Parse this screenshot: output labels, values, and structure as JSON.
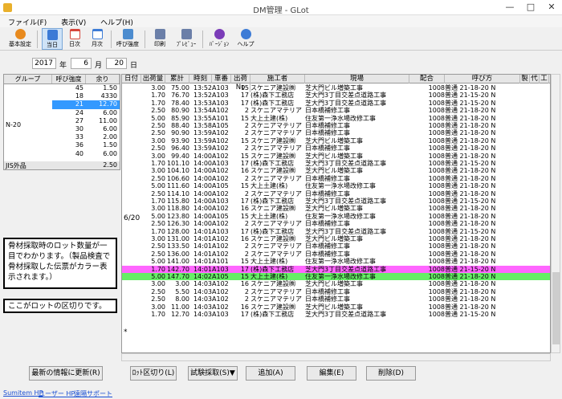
{
  "window": {
    "title": "DM管理 - GLot",
    "minimize": "—",
    "maximize": "□",
    "close": "✕"
  },
  "menu": [
    "ファイル(F)",
    "表示(V)",
    "ヘルプ(H)"
  ],
  "toolbar": [
    {
      "label": "基本設定",
      "icon": "gear-icon",
      "color": "#e88a1e"
    },
    {
      "label": "当日",
      "icon": "calendar-today-icon",
      "color": "#3c7bd6"
    },
    {
      "label": "日次",
      "icon": "calendar-day-icon",
      "color": "#d6463c"
    },
    {
      "label": "月次",
      "icon": "calendar-month-icon",
      "color": "#3c7bd6"
    },
    {
      "label": "呼び強度",
      "icon": "strength-icon",
      "color": "#4c8ccf"
    },
    {
      "label": "印刷",
      "icon": "print-icon",
      "color": "#6b7fa8"
    },
    {
      "label": "ﾌﾟﾚﾋﾞｭｰ",
      "icon": "preview-icon",
      "color": "#6b7fa8"
    },
    {
      "label": "ﾊﾞｰｼﾞｮﾝ",
      "icon": "info-icon",
      "color": "#7b3cb8"
    },
    {
      "label": "ヘルプ",
      "icon": "help-icon",
      "color": "#3c7bd6"
    }
  ],
  "date": {
    "year": "2017",
    "year_label": "年",
    "month": "6",
    "month_label": "月",
    "day": "20",
    "day_label": "日"
  },
  "left_panel": {
    "headers": [
      "グループ",
      "呼び強度",
      "余り"
    ],
    "group": "N-20",
    "rows": [
      {
        "strength": "45",
        "rest": "1.50"
      },
      {
        "strength": "18",
        "rest": "4330"
      },
      {
        "strength": "21",
        "rest": "12.70",
        "selected": true
      },
      {
        "strength": "24",
        "rest": "6.00"
      },
      {
        "strength": "27",
        "rest": "11.00"
      },
      {
        "strength": "30",
        "rest": "6.00"
      },
      {
        "strength": "33",
        "rest": "2.00"
      },
      {
        "strength": "36",
        "rest": "1.50"
      },
      {
        "strength": "40",
        "rest": "6.00"
      }
    ],
    "footer_group": "JIS外品",
    "footer_rest": "2.50"
  },
  "callouts": {
    "note1": "骨材採取時のロット数量が一目でわかります。（製品検査で骨材採取した伝票がカラー表示されます。）",
    "note2": "ここがロットの区切りです。"
  },
  "grid": {
    "headers": [
      "日付",
      "出荷量",
      "累計",
      "時刻",
      "車番",
      "出荷No",
      "施工者",
      "現場",
      "配合",
      "呼び方",
      "製",
      "代",
      "工"
    ],
    "date_label": "6/20",
    "marker": "*",
    "rows": [
      [
        "3.00",
        "75.00",
        "13:52",
        "A103",
        "15",
        "スケニア建設㈱",
        "芝大門ビル増築工事",
        "1008",
        "普通 21-18-20 N"
      ],
      [
        "1.70",
        "76.70",
        "13:52",
        "A103",
        "17",
        "(株)森下工務店",
        "芝大門3丁目交差点道路工事",
        "1008",
        "普通 21-15-20 N"
      ],
      [
        "1.70",
        "78.40",
        "13:53",
        "A103",
        "17",
        "(株)森下工務店",
        "芝大門3丁目交差点道路工事",
        "1008",
        "普通 21-15-20 N"
      ],
      [
        "2.50",
        "80.90",
        "13:54",
        "A102",
        "2",
        "スケニアマテリア",
        "日本橋補修工事",
        "1008",
        "普通 21-18-20 N"
      ],
      [
        "5.00",
        "85.90",
        "13:55",
        "A101",
        "15",
        "大上土建(株)",
        "住友第一浄水場改修工事",
        "1008",
        "普通 21-18-20 N"
      ],
      [
        "2.50",
        "88.40",
        "13:58",
        "A105",
        "2",
        "スケニアマテリア",
        "日本橋補修工事",
        "1008",
        "普通 21-18-20 N"
      ],
      [
        "2.50",
        "90.90",
        "13:59",
        "A102",
        "2",
        "スケニアマテリア",
        "日本橋補修工事",
        "1008",
        "普通 21-18-20 N"
      ],
      [
        "3.00",
        "93.90",
        "13:59",
        "A102",
        "15",
        "スケニア建設㈱",
        "芝大門ビル増築工事",
        "1008",
        "普通 21-18-20 N"
      ],
      [
        "2.50",
        "96.40",
        "13:59",
        "A102",
        "2",
        "スケニアマテリア",
        "日本橋補修工事",
        "1008",
        "普通 21-18-20 N"
      ],
      [
        "3.00",
        "99.40",
        "14:00",
        "A102",
        "15",
        "スケニア建設㈱",
        "芝大門ビル増築工事",
        "1008",
        "普通 21-18-20 N"
      ],
      [
        "1.70",
        "101.10",
        "14:00",
        "A103",
        "17",
        "(株)森下工務店",
        "芝大門3丁目交差点道路工事",
        "1008",
        "普通 21-15-20 N"
      ],
      [
        "3.00",
        "104.10",
        "14:00",
        "A102",
        "16",
        "スケニア建設㈱",
        "芝大門ビル増築工事",
        "1008",
        "普通 21-18-20 N"
      ],
      [
        "2.50",
        "106.60",
        "14:00",
        "A102",
        "2",
        "スケニアマテリア",
        "日本橋補修工事",
        "1008",
        "普通 21-18-20 N"
      ],
      [
        "5.00",
        "111.60",
        "14:00",
        "A105",
        "15",
        "大上土建(株)",
        "住友第一浄水場改修工事",
        "1008",
        "普通 21-18-20 N"
      ],
      [
        "2.50",
        "114.10",
        "14:00",
        "A102",
        "2",
        "スケニアマテリア",
        "日本橋補修工事",
        "1008",
        "普通 21-18-20 N"
      ],
      [
        "1.70",
        "115.80",
        "14:00",
        "A103",
        "17",
        "(株)森下工務店",
        "芝大門3丁目交差点道路工事",
        "1008",
        "普通 21-15-20 N"
      ],
      [
        "3.00",
        "118.80",
        "14:00",
        "A102",
        "16",
        "スケニア建設㈱",
        "芝大門ビル増築工事",
        "1008",
        "普通 21-18-20 N"
      ],
      [
        "5.00",
        "123.80",
        "14:00",
        "A105",
        "15",
        "大上土建(株)",
        "住友第一浄水場改修工事",
        "1008",
        "普通 21-18-20 N"
      ],
      [
        "2.50",
        "126.30",
        "14:00",
        "A102",
        "2",
        "スケニアマテリア",
        "日本橋補修工事",
        "1008",
        "普通 21-18-20 N"
      ],
      [
        "1.70",
        "128.00",
        "14:01",
        "A103",
        "17",
        "(株)森下工務店",
        "芝大門3丁目交差点道路工事",
        "1008",
        "普通 21-15-20 N"
      ],
      [
        "3.00",
        "131.00",
        "14:01",
        "A102",
        "16",
        "スケニア建設㈱",
        "芝大門ビル増築工事",
        "1008",
        "普通 21-18-20 N"
      ],
      [
        "2.50",
        "133.50",
        "14:01",
        "A102",
        "2",
        "スケニアマテリア",
        "日本橋補修工事",
        "1008",
        "普通 21-18-20 N"
      ],
      [
        "2.50",
        "136.00",
        "14:01",
        "A102",
        "2",
        "スケニアマテリア",
        "日本橋補修工事",
        "1008",
        "普通 21-18-20 N"
      ],
      [
        "5.00",
        "141.00",
        "14:01",
        "A101",
        "15",
        "大上土建(株)",
        "住友第一浄水場改修工事",
        "1008",
        "普通 21-18-20 N"
      ],
      [
        "1.70",
        "142.70",
        "14:01",
        "A103",
        "17",
        "(株)森下工務店",
        "芝大門3丁目交差点道路工事",
        "1008",
        "普通 21-15-20 N",
        "pink"
      ],
      [
        "5.00",
        "147.70",
        "14:02",
        "A105",
        "15",
        "大上土建(株)",
        "住友第一浄水場改修工事",
        "1008",
        "普通 21-18-20 N",
        "green"
      ],
      [
        "3.00",
        "3.00",
        "14:03",
        "A102",
        "16",
        "スケニア建設㈱",
        "芝大門ビル増築工事",
        "1008",
        "普通 21-18-20 N"
      ],
      [
        "2.50",
        "5.50",
        "14:03",
        "A102",
        "2",
        "スケニアマテリア",
        "日本橋補修工事",
        "1008",
        "普通 21-18-20 N"
      ],
      [
        "2.50",
        "8.00",
        "14:03",
        "A102",
        "2",
        "スケニアマテリア",
        "日本橋補修工事",
        "1008",
        "普通 21-18-20 N"
      ],
      [
        "3.00",
        "11.00",
        "14:03",
        "A102",
        "16",
        "スケニア建設㈱",
        "芝大門ビル増築工事",
        "1008",
        "普通 21-18-20 N"
      ],
      [
        "1.70",
        "12.70",
        "14:03",
        "A103",
        "17",
        "(株)森下工務店",
        "芝大門3丁目交差点道路工事",
        "1008",
        "普通 21-15-20 N"
      ]
    ]
  },
  "buttons": {
    "refresh": "最新の情報に更新(R)",
    "lot": "ﾛｯﾄ区切り(L)",
    "test": "試験採取(S)▼",
    "add": "追加(A)",
    "edit": "編集(E)",
    "delete": "削除(D)"
  },
  "links": [
    "Sumitem HP",
    "ユーザー HP",
    "遠隔サポート"
  ]
}
